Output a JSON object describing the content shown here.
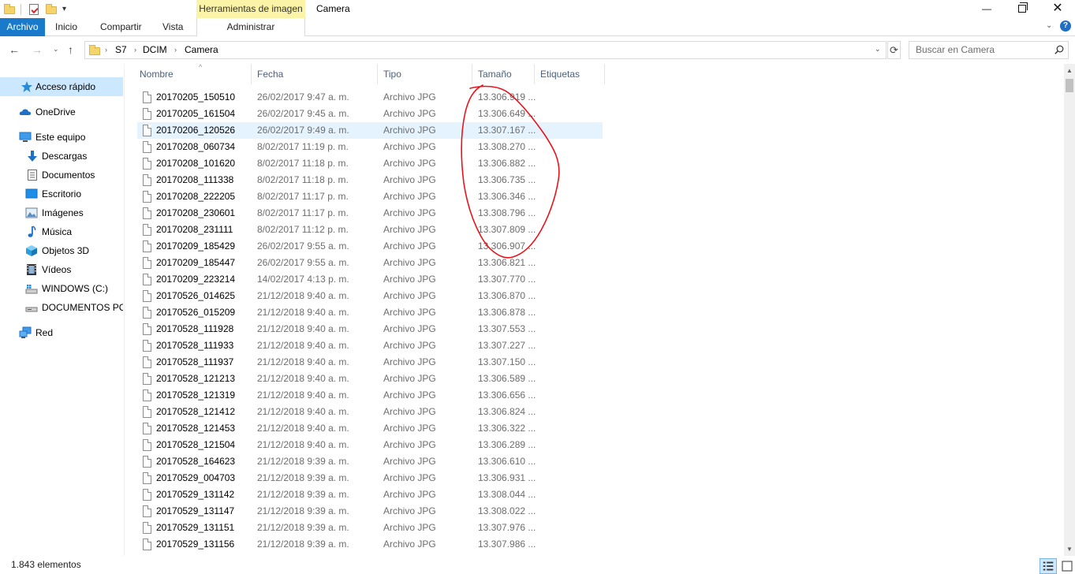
{
  "window": {
    "title": "Camera",
    "contextual_tab_group": "Herramientas de imagen",
    "minimize_glyph": "—",
    "close_glyph": "✕"
  },
  "ribbon": {
    "tabs": [
      "Archivo",
      "Inicio",
      "Compartir",
      "Vista",
      "Administrar"
    ],
    "expand_glyph": "⌄",
    "help_glyph": "?"
  },
  "navigation": {
    "back_glyph": "←",
    "forward_glyph": "→",
    "recent_glyph": "⌄",
    "up_glyph": "↑",
    "breadcrumb": [
      "S7",
      "DCIM",
      "Camera"
    ],
    "breadcrumb_sep": "›",
    "refresh_glyph": "⟳",
    "dropdown_glyph": "⌄",
    "search_placeholder": "Buscar en Camera"
  },
  "sidebar": {
    "items": [
      {
        "label": "Acceso rápido",
        "icon": "star-icon",
        "selected": true
      },
      {
        "label": "OneDrive",
        "icon": "cloud-icon"
      },
      {
        "label": "Este equipo",
        "icon": "computer-icon"
      },
      {
        "label": "Descargas",
        "icon": "download-icon"
      },
      {
        "label": "Documentos",
        "icon": "document-icon"
      },
      {
        "label": "Escritorio",
        "icon": "desktop-icon"
      },
      {
        "label": "Imágenes",
        "icon": "pictures-icon"
      },
      {
        "label": "Música",
        "icon": "music-icon"
      },
      {
        "label": "Objetos 3D",
        "icon": "cube-icon"
      },
      {
        "label": "Vídeos",
        "icon": "video-icon"
      },
      {
        "label": "WINDOWS (C:)",
        "icon": "drive-c-icon"
      },
      {
        "label": "DOCUMENTOS PC (",
        "icon": "drive-icon"
      },
      {
        "label": "Red",
        "icon": "network-icon"
      }
    ]
  },
  "columns": [
    "Nombre",
    "Fecha",
    "Tipo",
    "Tamaño",
    "Etiquetas"
  ],
  "sort_glyph": "^",
  "files": [
    {
      "name": "20170205_150510",
      "date": "26/02/2017 9:47 a. m.",
      "type": "Archivo JPG",
      "size": "13.306.919 ..."
    },
    {
      "name": "20170205_161504",
      "date": "26/02/2017 9:45 a. m.",
      "type": "Archivo JPG",
      "size": "13.306.649 ..."
    },
    {
      "name": "20170206_120526",
      "date": "26/02/2017 9:49 a. m.",
      "type": "Archivo JPG",
      "size": "13.307.167 ..."
    },
    {
      "name": "20170208_060734",
      "date": "8/02/2017 11:19 p. m.",
      "type": "Archivo JPG",
      "size": "13.308.270 ..."
    },
    {
      "name": "20170208_101620",
      "date": "8/02/2017 11:18 p. m.",
      "type": "Archivo JPG",
      "size": "13.306.882 ..."
    },
    {
      "name": "20170208_111338",
      "date": "8/02/2017 11:18 p. m.",
      "type": "Archivo JPG",
      "size": "13.306.735 ..."
    },
    {
      "name": "20170208_222205",
      "date": "8/02/2017 11:17 p. m.",
      "type": "Archivo JPG",
      "size": "13.306.346 ..."
    },
    {
      "name": "20170208_230601",
      "date": "8/02/2017 11:17 p. m.",
      "type": "Archivo JPG",
      "size": "13.308.796 ..."
    },
    {
      "name": "20170208_231111",
      "date": "8/02/2017 11:12 p. m.",
      "type": "Archivo JPG",
      "size": "13.307.809 ..."
    },
    {
      "name": "20170209_185429",
      "date": "26/02/2017 9:55 a. m.",
      "type": "Archivo JPG",
      "size": "13.306.907 ..."
    },
    {
      "name": "20170209_185447",
      "date": "26/02/2017 9:55 a. m.",
      "type": "Archivo JPG",
      "size": "13.306.821 ..."
    },
    {
      "name": "20170209_223214",
      "date": "14/02/2017 4:13 p. m.",
      "type": "Archivo JPG",
      "size": "13.307.770 ..."
    },
    {
      "name": "20170526_014625",
      "date": "21/12/2018 9:40 a. m.",
      "type": "Archivo JPG",
      "size": "13.306.870 ..."
    },
    {
      "name": "20170526_015209",
      "date": "21/12/2018 9:40 a. m.",
      "type": "Archivo JPG",
      "size": "13.306.878 ..."
    },
    {
      "name": "20170528_111928",
      "date": "21/12/2018 9:40 a. m.",
      "type": "Archivo JPG",
      "size": "13.307.553 ..."
    },
    {
      "name": "20170528_111933",
      "date": "21/12/2018 9:40 a. m.",
      "type": "Archivo JPG",
      "size": "13.307.227 ..."
    },
    {
      "name": "20170528_111937",
      "date": "21/12/2018 9:40 a. m.",
      "type": "Archivo JPG",
      "size": "13.307.150 ..."
    },
    {
      "name": "20170528_121213",
      "date": "21/12/2018 9:40 a. m.",
      "type": "Archivo JPG",
      "size": "13.306.589 ..."
    },
    {
      "name": "20170528_121319",
      "date": "21/12/2018 9:40 a. m.",
      "type": "Archivo JPG",
      "size": "13.306.656 ..."
    },
    {
      "name": "20170528_121412",
      "date": "21/12/2018 9:40 a. m.",
      "type": "Archivo JPG",
      "size": "13.306.824 ..."
    },
    {
      "name": "20170528_121453",
      "date": "21/12/2018 9:40 a. m.",
      "type": "Archivo JPG",
      "size": "13.306.322 ..."
    },
    {
      "name": "20170528_121504",
      "date": "21/12/2018 9:40 a. m.",
      "type": "Archivo JPG",
      "size": "13.306.289 ..."
    },
    {
      "name": "20170528_164623",
      "date": "21/12/2018 9:39 a. m.",
      "type": "Archivo JPG",
      "size": "13.306.610 ..."
    },
    {
      "name": "20170529_004703",
      "date": "21/12/2018 9:39 a. m.",
      "type": "Archivo JPG",
      "size": "13.306.931 ..."
    },
    {
      "name": "20170529_131142",
      "date": "21/12/2018 9:39 a. m.",
      "type": "Archivo JPG",
      "size": "13.308.044 ..."
    },
    {
      "name": "20170529_131147",
      "date": "21/12/2018 9:39 a. m.",
      "type": "Archivo JPG",
      "size": "13.308.022 ..."
    },
    {
      "name": "20170529_131151",
      "date": "21/12/2018 9:39 a. m.",
      "type": "Archivo JPG",
      "size": "13.307.976 ..."
    },
    {
      "name": "20170529_131156",
      "date": "21/12/2018 9:39 a. m.",
      "type": "Archivo JPG",
      "size": "13.307.986 ..."
    }
  ],
  "hover_row": 2,
  "status": {
    "item_count": "1.843 elementos"
  },
  "scrollbar": {
    "up_glyph": "▲",
    "down_glyph": "▼"
  },
  "colors": {
    "accent": "#1979ca",
    "context_tab": "#fbf3a6",
    "selection": "#cce8ff",
    "annotation": "#e8141b"
  }
}
